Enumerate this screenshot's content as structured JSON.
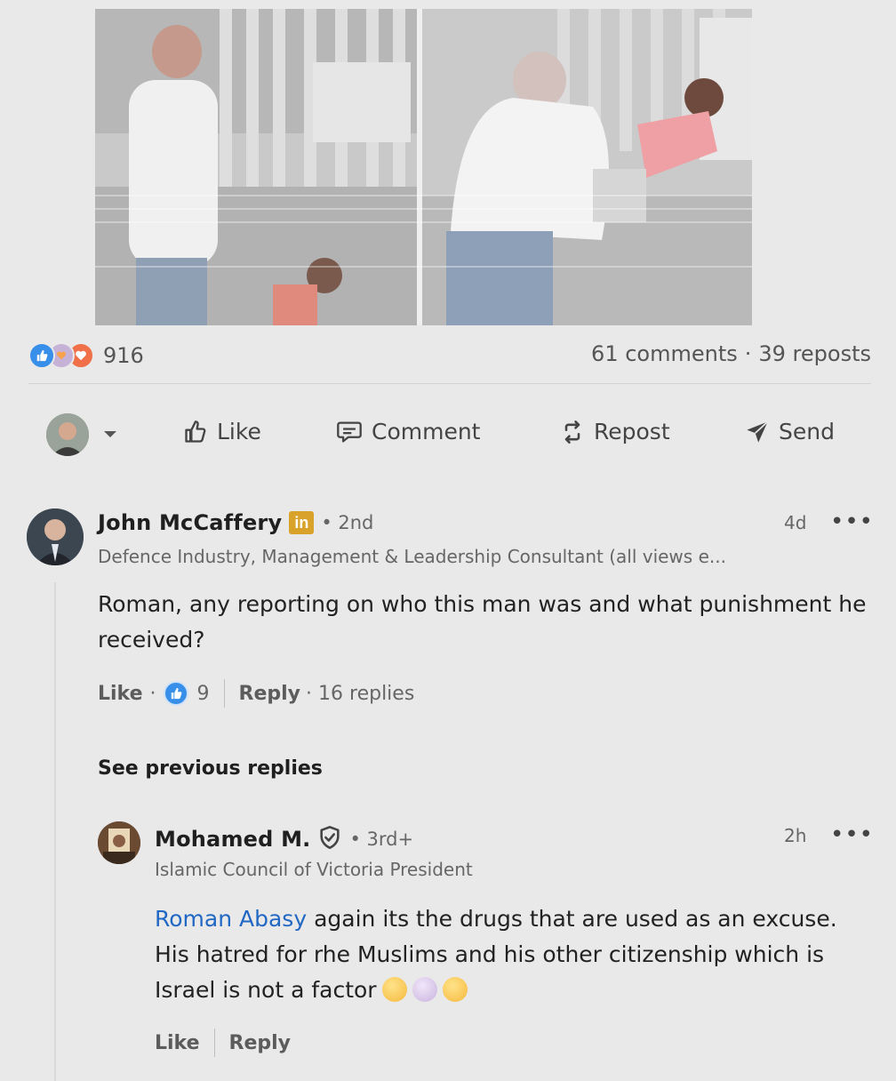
{
  "post": {
    "reaction_count": "916",
    "comments_count": "61 comments",
    "separator": "·",
    "reposts_count": "39 reposts",
    "reaction_icons": [
      "like-icon",
      "support-icon",
      "love-icon"
    ]
  },
  "actions": {
    "like_label": "Like",
    "comment_label": "Comment",
    "repost_label": "Repost",
    "send_label": "Send"
  },
  "comment1": {
    "author": "John McCaffery",
    "degree": "• 2nd",
    "headline": "Defence Industry, Management & Leadership Consultant (all views e...",
    "time": "4d",
    "more": "•••",
    "body": "Roman, any reporting on who this man was and what punishment he received?",
    "like_label": "Like",
    "like_dot": "·",
    "like_count": "9",
    "reply_label": "Reply",
    "replies": "· 16 replies"
  },
  "see_previous": "See previous replies",
  "reply1": {
    "author": "Mohamed M.",
    "degree": "• 3rd+",
    "headline": "Islamic Council of Victoria President",
    "time": "2h",
    "more": "•••",
    "mention": "Roman Abasy",
    "body": " again its the drugs that are used as an excuse. His hatred for rhe Muslims and his other citizenship which is Israel is not a factor",
    "like_label": "Like",
    "reply_label": "Reply"
  },
  "colors": {
    "background": "#e9e9e9",
    "link": "#2167c4",
    "like_blue": "#378fe9",
    "love_orange": "#f0704a",
    "premium_gold": "#d9a22b"
  }
}
